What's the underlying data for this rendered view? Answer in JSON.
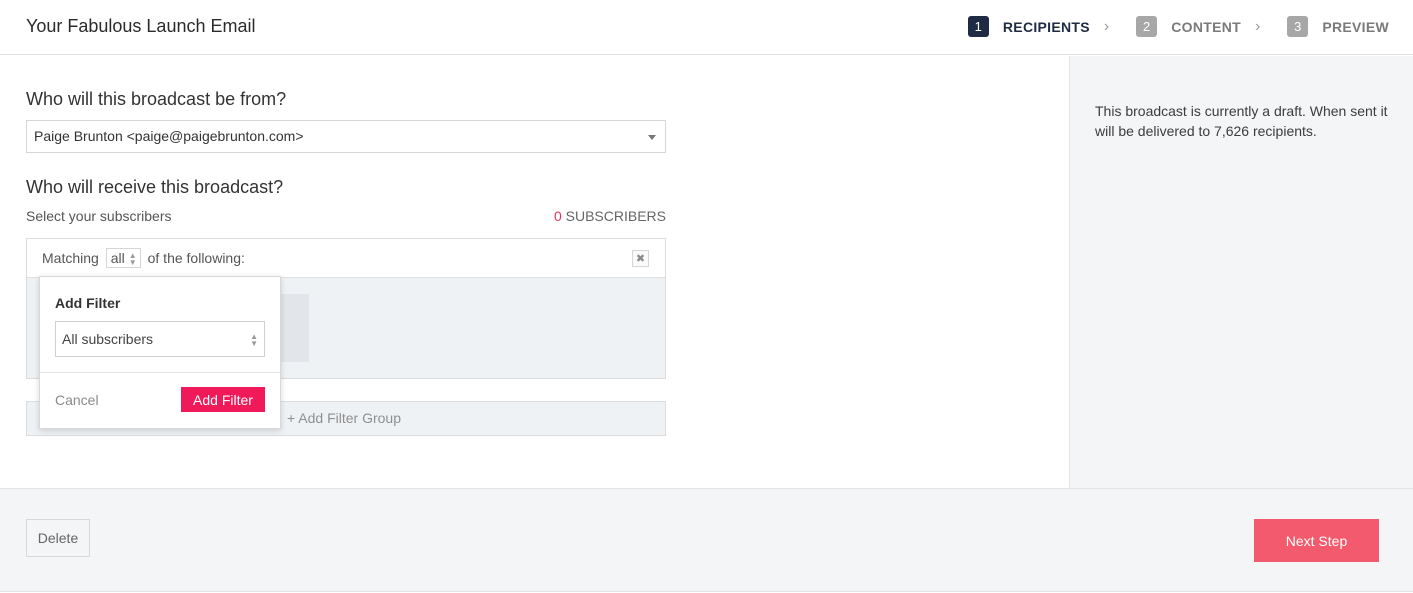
{
  "header": {
    "title": "Your Fabulous Launch Email",
    "steps": [
      {
        "num": "1",
        "label": "RECIPIENTS",
        "active": true
      },
      {
        "num": "2",
        "label": "CONTENT",
        "active": false
      },
      {
        "num": "3",
        "label": "PREVIEW",
        "active": false
      }
    ],
    "separator_icon": "chevron-right-icon"
  },
  "from": {
    "question": "Who will this broadcast be from?",
    "value": "Paige Brunton <paige@paigebrunton.com>"
  },
  "recipients": {
    "question": "Who will receive this broadcast?",
    "select_label": "Select your subscribers",
    "count": "0",
    "count_label": "SUBSCRIBERS"
  },
  "filter": {
    "matching_prefix": "Matching",
    "matching_value": "all",
    "matching_suffix": "of the following:",
    "close_icon": "close-icon",
    "add_group_label": "+ Add Filter Group"
  },
  "popover": {
    "title": "Add Filter",
    "select_value": "All subscribers",
    "cancel_label": "Cancel",
    "add_label": "Add Filter"
  },
  "sidebar": {
    "text": "This broadcast is currently a draft. When sent it will be delivered to 7,626 recipients."
  },
  "footer": {
    "delete_label": "Delete",
    "next_label": "Next Step"
  },
  "colors": {
    "accent": "#f0195a",
    "next_button": "#f35a6d",
    "active_step": "#1f2a44",
    "inactive_step": "#a7a7a7",
    "count_highlight": "#e8335a"
  }
}
